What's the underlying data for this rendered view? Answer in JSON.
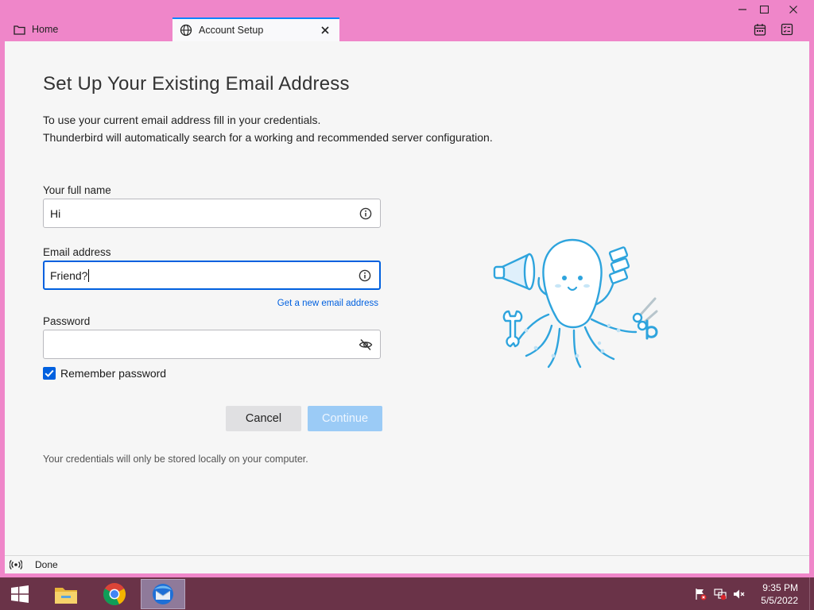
{
  "tabs": [
    {
      "label": "Home",
      "icon": "folder-icon"
    },
    {
      "label": "Account Setup",
      "icon": "globe-icon"
    }
  ],
  "page": {
    "title": "Set Up Your Existing Email Address",
    "intro_line1": "To use your current email address fill in your credentials.",
    "intro_line2": "Thunderbird will automatically search for a working and recommended server configuration."
  },
  "form": {
    "full_name_label": "Your full name",
    "full_name_value": "Hi",
    "email_label": "Email address",
    "email_value": "Friend?",
    "new_email_link": "Get a new email address",
    "password_label": "Password",
    "password_value": "",
    "remember_label": "Remember password",
    "remember_checked": true
  },
  "buttons": {
    "cancel": "Cancel",
    "continue": "Continue"
  },
  "footer_note": "Your credentials will only be stored locally on your computer.",
  "status": {
    "text": "Done"
  },
  "taskbar": {
    "time": "9:35 PM",
    "date": "5/5/2022"
  },
  "colors": {
    "accent": "#0060df",
    "window_frame": "#ef86c9",
    "taskbar": "#6a3348",
    "mascot": "#2ea4dd"
  }
}
